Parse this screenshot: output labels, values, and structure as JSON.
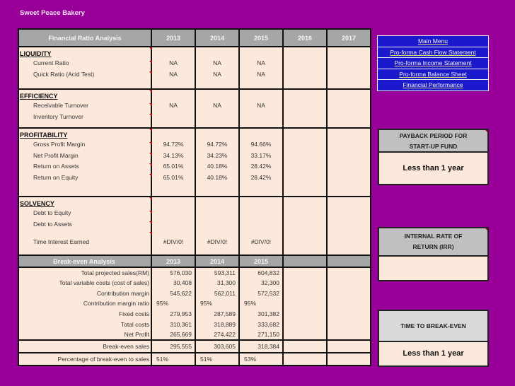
{
  "app_title": "Sweet Peace Bakery",
  "ratio_table": {
    "header": "Financial Ratio Analysis",
    "years": [
      "2013",
      "2014",
      "2015",
      "2016",
      "2017"
    ],
    "sections": [
      {
        "name": "LIQUIDITY",
        "rows": [
          {
            "label": "Current Ratio",
            "values": [
              "NA",
              "NA",
              "NA",
              "",
              ""
            ]
          },
          {
            "label": "Quick Ratio (Acid Test)",
            "values": [
              "NA",
              "NA",
              "NA",
              "",
              ""
            ]
          }
        ]
      },
      {
        "name": "EFFICIENCY",
        "rows": [
          {
            "label": "Receivable Turnover",
            "values": [
              "NA",
              "NA",
              "NA",
              "",
              ""
            ]
          },
          {
            "label": "Inventory Turnover",
            "values": [
              "",
              "",
              "",
              "",
              ""
            ]
          }
        ]
      },
      {
        "name": "PROFITABILITY",
        "rows": [
          {
            "label": "Gross Profit Margin",
            "values": [
              "94.72%",
              "94.72%",
              "94.66%",
              "",
              ""
            ]
          },
          {
            "label": "Net Profit Margin",
            "values": [
              "34.13%",
              "34.23%",
              "33.17%",
              "",
              ""
            ]
          },
          {
            "label": "Return on Assets",
            "values": [
              "65.01%",
              "40.18%",
              "28.42%",
              "",
              ""
            ]
          },
          {
            "label": "Return on Equity",
            "values": [
              "65.01%",
              "40.18%",
              "28.42%",
              "",
              ""
            ]
          }
        ]
      },
      {
        "name": "SOLVENCY",
        "rows": [
          {
            "label": "Debt to Equity",
            "values": [
              "",
              "",
              "",
              "",
              ""
            ]
          },
          {
            "label": "Debt to Assets",
            "values": [
              "",
              "",
              "",
              "",
              ""
            ]
          },
          {
            "label": "Time Interest Earned",
            "values": [
              "#DIV/0!",
              "#DIV/0!",
              "#DIV/0!",
              "",
              ""
            ]
          }
        ]
      }
    ]
  },
  "breakeven_table": {
    "header": "Break-even Analysis",
    "years": [
      "2013",
      "2014",
      "2015",
      "",
      ""
    ],
    "rows": [
      {
        "label": "Total projected sales(RM)",
        "values": [
          "576,030",
          "593,311",
          "604,832"
        ]
      },
      {
        "label": "Total variable costs (cost of sales)",
        "values": [
          "30,408",
          "31,300",
          "32,300"
        ]
      },
      {
        "label": "Contribution margin",
        "values": [
          "545,622",
          "562,011",
          "572,532"
        ]
      },
      {
        "label": "Contribution margin ratio",
        "values": [
          "95%",
          "95%",
          "95%"
        ]
      },
      {
        "label": "Fixed costs",
        "values": [
          "279,953",
          "287,589",
          "301,382"
        ]
      },
      {
        "label": "Total costs",
        "values": [
          "310,361",
          "318,889",
          "333,682"
        ]
      },
      {
        "label": "Net Profit",
        "values": [
          "265,669",
          "274,422",
          "271,150"
        ]
      }
    ],
    "breakeven_sales": {
      "label": "Break-even sales",
      "values": [
        "295,555",
        "303,605",
        "318,384"
      ]
    },
    "breakeven_pct": {
      "label": "Percentage of break-even to sales",
      "values": [
        "51%",
        "51%",
        "53%"
      ]
    }
  },
  "menu": {
    "items": [
      "Main Menu",
      "Pro-forma Cash Flow Statement",
      "Pro-forma Income Statement",
      "Pro-forma Balance Sheet",
      "Financial Performance"
    ]
  },
  "payback": {
    "title_line1": "PAYBACK PERIOD FOR",
    "title_line2": "START-UP FUND",
    "value": "Less than 1 year"
  },
  "irr": {
    "title_line1": "INTERNAL RATE OF",
    "title_line2": "RETURN (IRR)",
    "value": ""
  },
  "breakeven_time": {
    "title": "TIME TO BREAK-EVEN",
    "value": "Less than 1 year"
  },
  "colors": {
    "background": "#990099",
    "header_gray": "#a6a6a6",
    "cell_bg": "#fde9dc",
    "menu_blue": "#1a1acc"
  }
}
